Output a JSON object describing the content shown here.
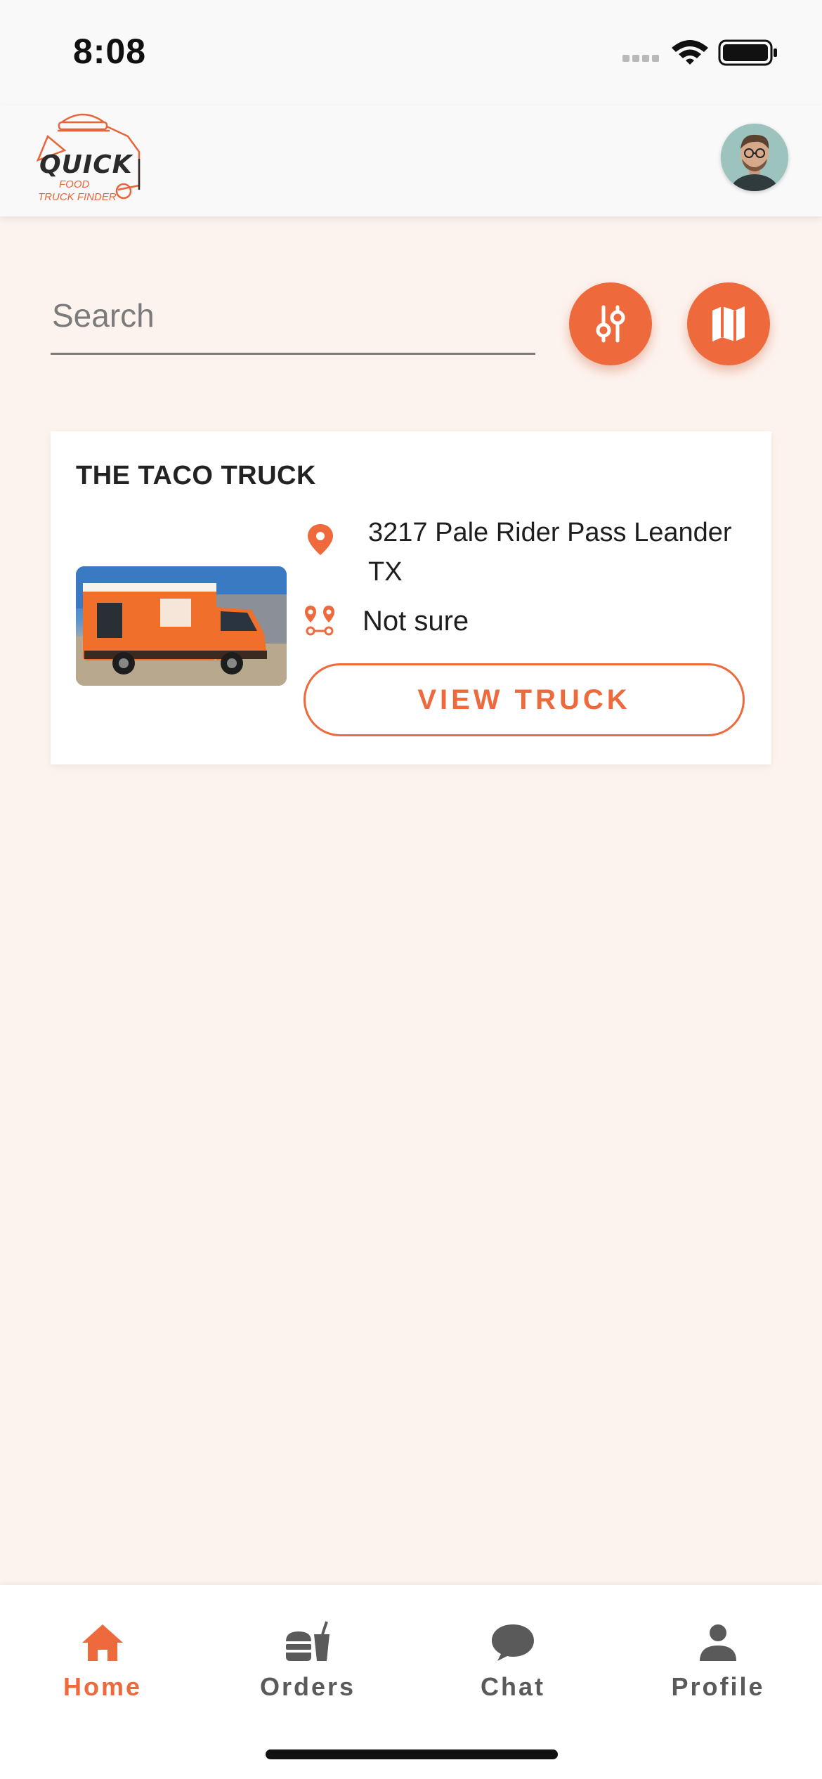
{
  "status_bar": {
    "time": "8:08"
  },
  "header": {
    "logo": {
      "word": "QUICK",
      "line1": "FOOD",
      "line2": "TRUCK FINDER"
    }
  },
  "search": {
    "placeholder": "Search"
  },
  "truck_card": {
    "name": "THE TACO TRUCK",
    "address": "3217 Pale Rider Pass Leander TX",
    "distance": "Not sure",
    "view_label": "VIEW TRUCK"
  },
  "bottom_nav": {
    "items": [
      {
        "label": "Home",
        "icon": "home-icon",
        "active": true
      },
      {
        "label": "Orders",
        "icon": "orders-icon",
        "active": false
      },
      {
        "label": "Chat",
        "icon": "chat-icon",
        "active": false
      },
      {
        "label": "Profile",
        "icon": "profile-icon",
        "active": false
      }
    ]
  },
  "colors": {
    "accent": "#ee6a3c",
    "background": "#fdf3ee",
    "inactive": "#5a5a5a"
  }
}
